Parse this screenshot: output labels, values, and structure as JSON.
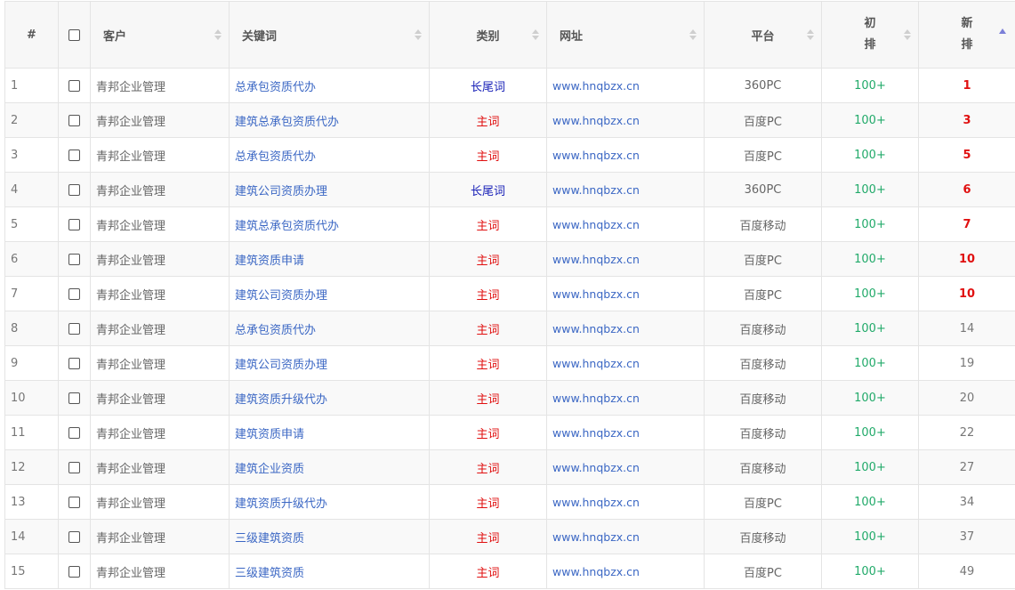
{
  "headers": {
    "index": "#",
    "customer": "客户",
    "keyword": "关键词",
    "category": "类别",
    "url": "网址",
    "platform": "平台",
    "initial_line1": "初",
    "initial_line2": "排",
    "new_line1": "新",
    "new_line2": "排"
  },
  "rows": [
    {
      "n": "1",
      "customer": "青邦企业管理",
      "keyword": "总承包资质代办",
      "category": "长尾词",
      "url": "www.hnqbzx.cn",
      "platform": "360PC",
      "initial": "100+",
      "new": "1"
    },
    {
      "n": "2",
      "customer": "青邦企业管理",
      "keyword": "建筑总承包资质代办",
      "category": "主词",
      "url": "www.hnqbzx.cn",
      "platform": "百度PC",
      "initial": "100+",
      "new": "3"
    },
    {
      "n": "3",
      "customer": "青邦企业管理",
      "keyword": "总承包资质代办",
      "category": "主词",
      "url": "www.hnqbzx.cn",
      "platform": "百度PC",
      "initial": "100+",
      "new": "5"
    },
    {
      "n": "4",
      "customer": "青邦企业管理",
      "keyword": "建筑公司资质办理",
      "category": "长尾词",
      "url": "www.hnqbzx.cn",
      "platform": "360PC",
      "initial": "100+",
      "new": "6"
    },
    {
      "n": "5",
      "customer": "青邦企业管理",
      "keyword": "建筑总承包资质代办",
      "category": "主词",
      "url": "www.hnqbzx.cn",
      "platform": "百度移动",
      "initial": "100+",
      "new": "7"
    },
    {
      "n": "6",
      "customer": "青邦企业管理",
      "keyword": "建筑资质申请",
      "category": "主词",
      "url": "www.hnqbzx.cn",
      "platform": "百度PC",
      "initial": "100+",
      "new": "10"
    },
    {
      "n": "7",
      "customer": "青邦企业管理",
      "keyword": "建筑公司资质办理",
      "category": "主词",
      "url": "www.hnqbzx.cn",
      "platform": "百度PC",
      "initial": "100+",
      "new": "10"
    },
    {
      "n": "8",
      "customer": "青邦企业管理",
      "keyword": "总承包资质代办",
      "category": "主词",
      "url": "www.hnqbzx.cn",
      "platform": "百度移动",
      "initial": "100+",
      "new": "14"
    },
    {
      "n": "9",
      "customer": "青邦企业管理",
      "keyword": "建筑公司资质办理",
      "category": "主词",
      "url": "www.hnqbzx.cn",
      "platform": "百度移动",
      "initial": "100+",
      "new": "19"
    },
    {
      "n": "10",
      "customer": "青邦企业管理",
      "keyword": "建筑资质升级代办",
      "category": "主词",
      "url": "www.hnqbzx.cn",
      "platform": "百度移动",
      "initial": "100+",
      "new": "20"
    },
    {
      "n": "11",
      "customer": "青邦企业管理",
      "keyword": "建筑资质申请",
      "category": "主词",
      "url": "www.hnqbzx.cn",
      "platform": "百度移动",
      "initial": "100+",
      "new": "22"
    },
    {
      "n": "12",
      "customer": "青邦企业管理",
      "keyword": "建筑企业资质",
      "category": "主词",
      "url": "www.hnqbzx.cn",
      "platform": "百度移动",
      "initial": "100+",
      "new": "27"
    },
    {
      "n": "13",
      "customer": "青邦企业管理",
      "keyword": "建筑资质升级代办",
      "category": "主词",
      "url": "www.hnqbzx.cn",
      "platform": "百度PC",
      "initial": "100+",
      "new": "34"
    },
    {
      "n": "14",
      "customer": "青邦企业管理",
      "keyword": "三级建筑资质",
      "category": "主词",
      "url": "www.hnqbzx.cn",
      "platform": "百度移动",
      "initial": "100+",
      "new": "37"
    },
    {
      "n": "15",
      "customer": "青邦企业管理",
      "keyword": "三级建筑资质",
      "category": "主词",
      "url": "www.hnqbzx.cn",
      "platform": "百度PC",
      "initial": "100+",
      "new": "49"
    }
  ],
  "colors": {
    "link": "#3b67c4",
    "category_long_tail": "#1a22b8",
    "category_main": "#e01010",
    "initial_rank": "#22aa6a",
    "new_rank_top10": "#e01010"
  }
}
